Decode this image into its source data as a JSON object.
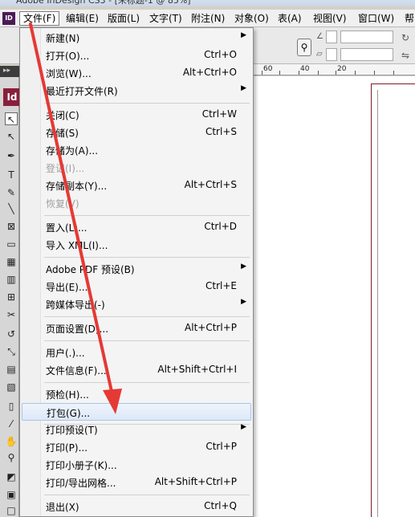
{
  "window": {
    "title": "Adobe InDesign CS3 - [未标题-1 @ 85%]"
  },
  "app_logo": "ID",
  "menubar": [
    {
      "label": "文件(F)",
      "active": true
    },
    {
      "label": "编辑(E)"
    },
    {
      "label": "版面(L)"
    },
    {
      "label": "文字(T)"
    },
    {
      "label": "附注(N)"
    },
    {
      "label": "对象(O)"
    },
    {
      "label": "表(A)"
    },
    {
      "label": "视图(V)"
    },
    {
      "label": "窗口(W)"
    },
    {
      "label": "帮"
    }
  ],
  "tool_panel": {
    "logo": "Id"
  },
  "ruler": {
    "labels": [
      "60",
      "40",
      "20"
    ]
  },
  "file_menu": {
    "items": [
      {
        "label": "新建(N)",
        "shortcut": "",
        "submenu": true
      },
      {
        "label": "打开(O)...",
        "shortcut": "Ctrl+O"
      },
      {
        "label": "浏览(W)...",
        "shortcut": "Alt+Ctrl+O"
      },
      {
        "label": "最近打开文件(R)",
        "shortcut": "",
        "submenu": true
      },
      {
        "label": "关闭(C)",
        "shortcut": "Ctrl+W"
      },
      {
        "label": "存储(S)",
        "shortcut": "Ctrl+S"
      },
      {
        "label": "存储为(A)...",
        "shortcut": ""
      },
      {
        "label": "登记(I)...",
        "shortcut": "",
        "disabled": true
      },
      {
        "label": "存储副本(Y)...",
        "shortcut": "Alt+Ctrl+S"
      },
      {
        "label": "恢复(V)",
        "shortcut": "",
        "disabled": true
      },
      {
        "label": "置入(L)...",
        "shortcut": "Ctrl+D"
      },
      {
        "label": "导入 XML(I)...",
        "shortcut": ""
      },
      {
        "label": "Adobe PDF 预设(B)",
        "shortcut": "",
        "submenu": true
      },
      {
        "label": "导出(E)...",
        "shortcut": "Ctrl+E"
      },
      {
        "label": "跨媒体导出(-)",
        "shortcut": "",
        "submenu": true
      },
      {
        "label": "页面设置(D)...",
        "shortcut": "Alt+Ctrl+P"
      },
      {
        "label": "用户(.)...",
        "shortcut": ""
      },
      {
        "label": "文件信息(F)...",
        "shortcut": "Alt+Shift+Ctrl+I"
      },
      {
        "label": "预检(H)...",
        "shortcut": ""
      },
      {
        "label": "打包(G)...",
        "shortcut": "",
        "highlighted": true
      },
      {
        "label": "打印预设(T)",
        "shortcut": "",
        "submenu": true
      },
      {
        "label": "打印(P)...",
        "shortcut": "Ctrl+P"
      },
      {
        "label": "打印小册子(K)...",
        "shortcut": ""
      },
      {
        "label": "打印/导出网格...",
        "shortcut": "Alt+Shift+Ctrl+P"
      },
      {
        "label": "退出(X)",
        "shortcut": "Ctrl+Q"
      }
    ]
  },
  "annotation": {
    "color": "#e53935"
  }
}
